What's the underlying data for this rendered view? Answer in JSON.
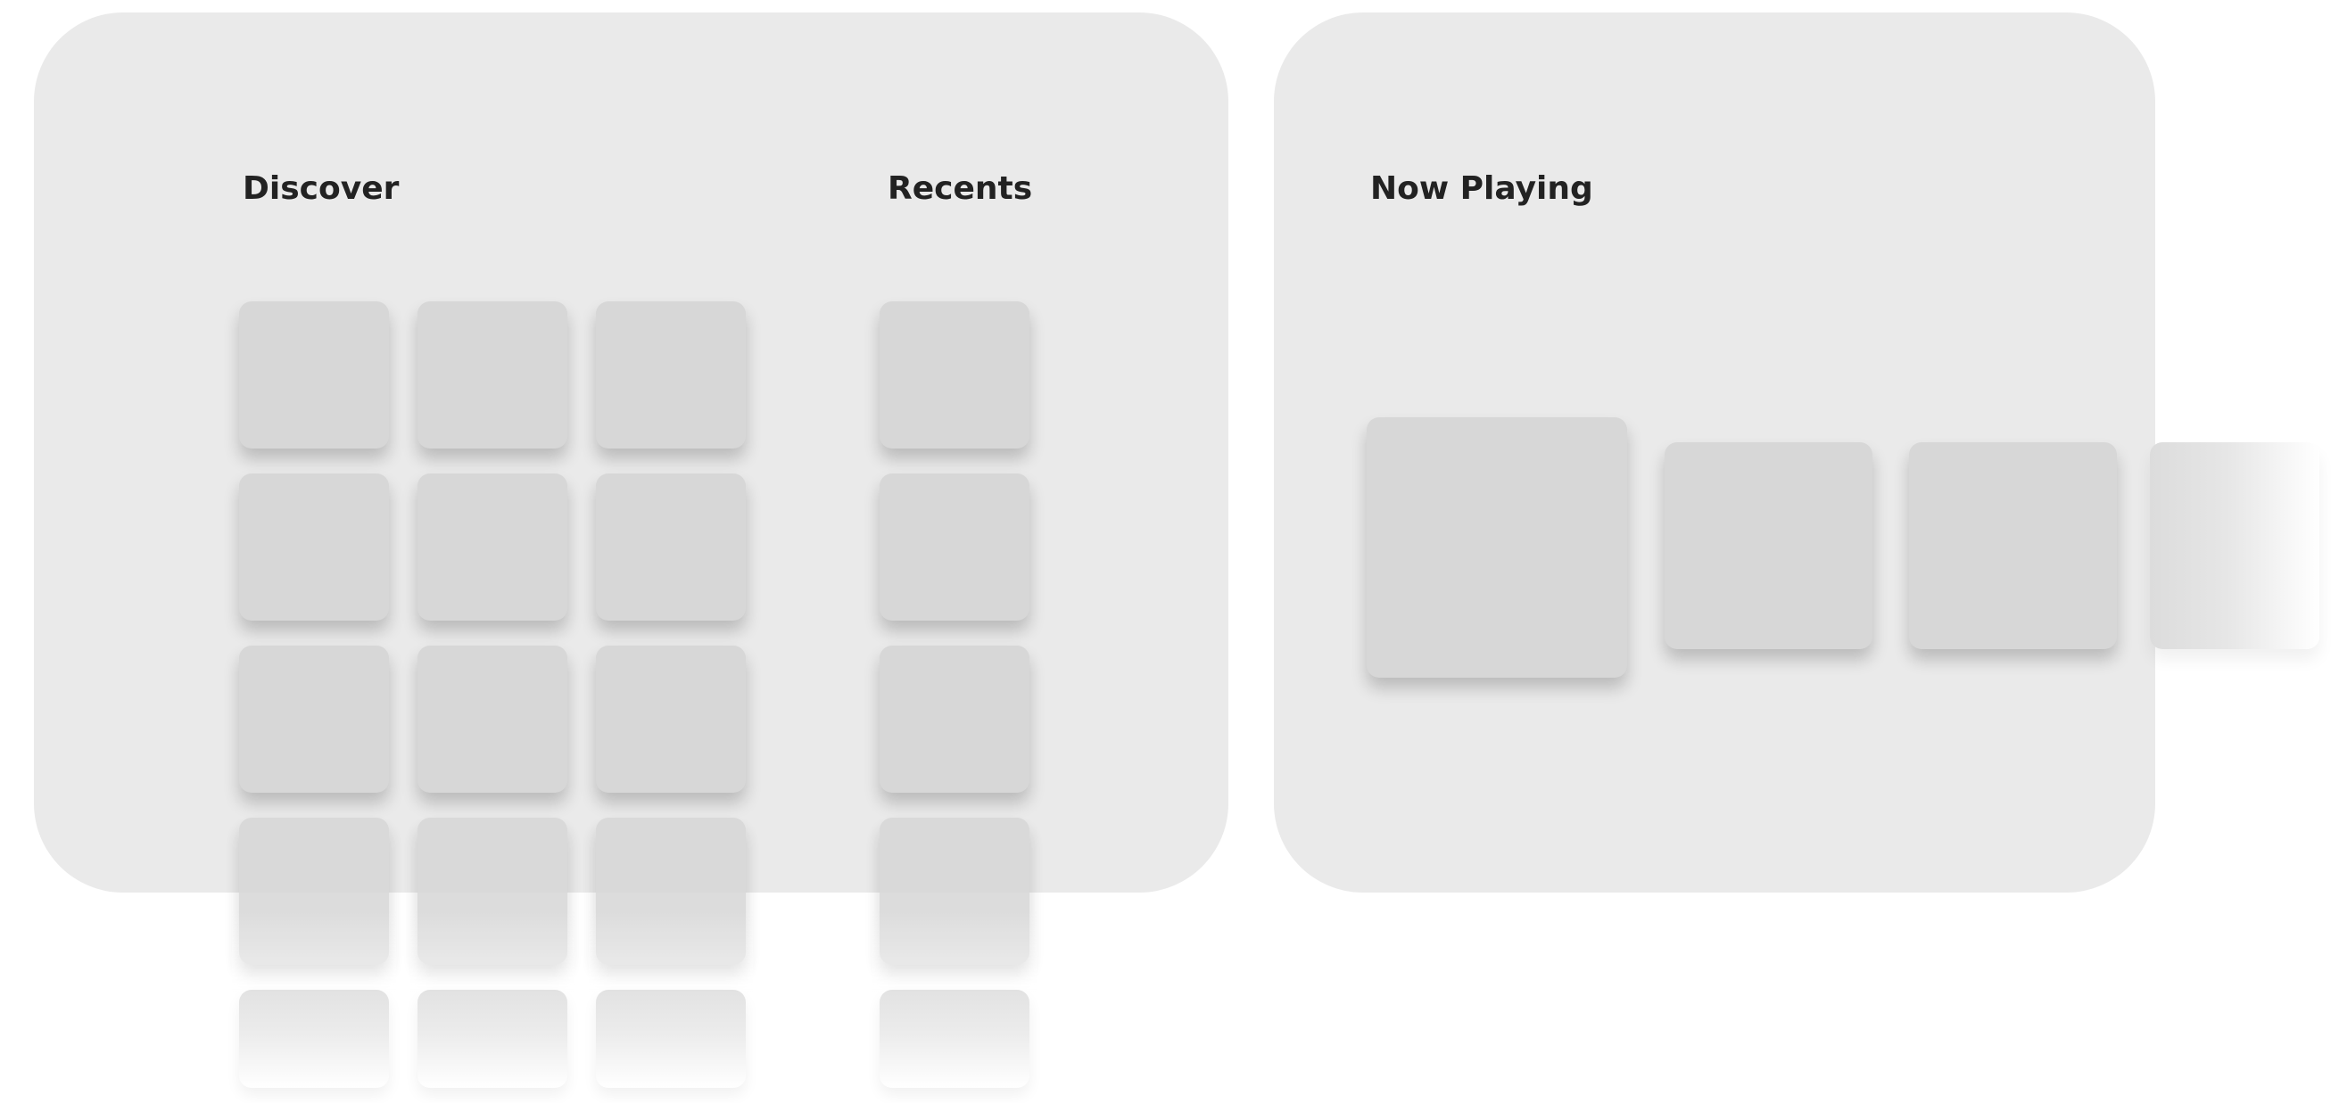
{
  "sections": {
    "discover": {
      "title": "Discover"
    },
    "recents": {
      "title": "Recents"
    },
    "now_playing": {
      "title": "Now Playing"
    }
  },
  "colors": {
    "panel_background": "#eaeaea",
    "tile_background": "#d7d7d7",
    "heading_text": "#222222",
    "page_background": "#ffffff"
  }
}
